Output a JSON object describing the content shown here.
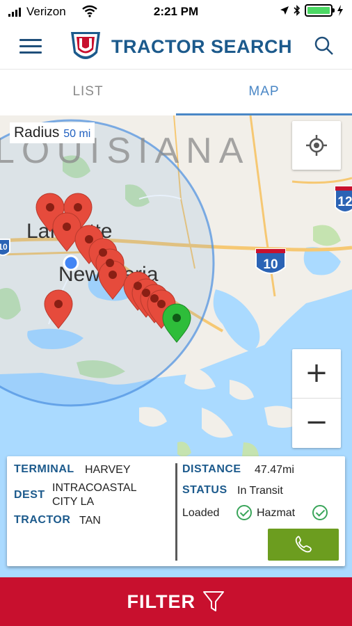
{
  "status_bar": {
    "carrier": "Verizon",
    "time": "2:21 PM"
  },
  "header": {
    "title": "TRACTOR SEARCH",
    "menu_icon": "hamburger-menu-icon",
    "search_icon": "search-icon"
  },
  "tabs": [
    {
      "label": "LIST",
      "active": false
    },
    {
      "label": "MAP",
      "active": true
    }
  ],
  "map": {
    "radius_label": "Radius",
    "radius_value": "50 mi",
    "labels": {
      "state": "LOUISIANA",
      "city1": "Lafayette",
      "city2": "New Iberia"
    },
    "shields": [
      "10",
      "10",
      "12"
    ],
    "zoom_in": "+",
    "zoom_out": "−",
    "colors": {
      "water": "#aadaff",
      "land": "#f2efe9",
      "marker_red": "#e64b3c",
      "marker_green": "#2ebd3a",
      "radius_circle": "#4a8fe0"
    }
  },
  "info": {
    "terminal_label": "TERMINAL",
    "terminal_value": "HARVEY",
    "dest_label": "DEST",
    "dest_value_line1": "INTRACOASTAL",
    "dest_value_line2": "CITY LA",
    "tractor_label": "TRACTOR",
    "tractor_value": "TAN",
    "distance_label": "DISTANCE",
    "distance_value": "47.47mi",
    "status_label": "STATUS",
    "status_value": "In Transit",
    "loaded_label": "Loaded",
    "hazmat_label": "Hazmat",
    "call_icon": "phone-icon"
  },
  "filter": {
    "label": "FILTER",
    "icon": "filter-funnel-icon"
  },
  "colors": {
    "brand_blue": "#1c5a8c",
    "tab_active": "#4a87c6",
    "filter_red": "#c8102e",
    "call_green": "#6c9d1f"
  }
}
